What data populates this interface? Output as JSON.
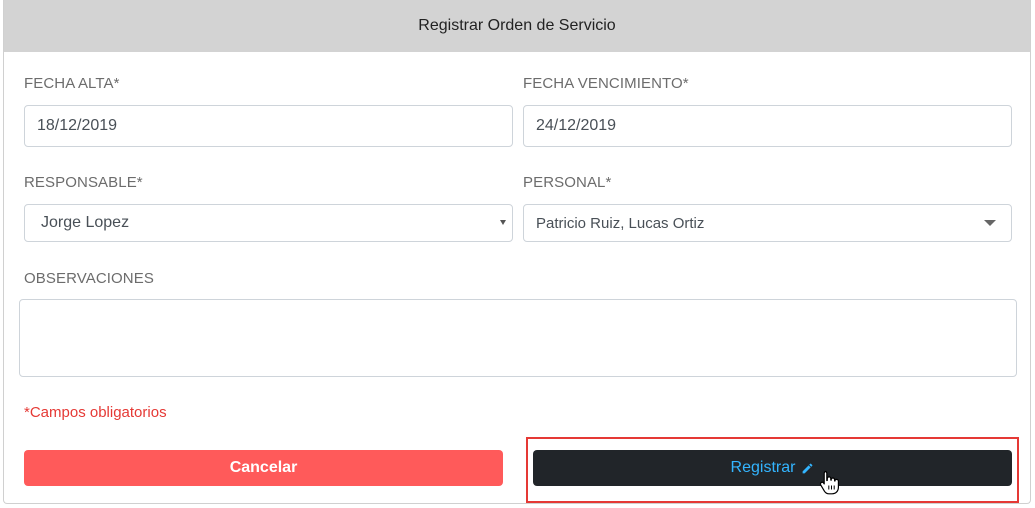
{
  "modal": {
    "title": "Registrar Orden de Servicio"
  },
  "form": {
    "fecha_alta": {
      "label": "FECHA ALTA*",
      "value": "18/12/2019"
    },
    "fecha_vencimiento": {
      "label": "FECHA VENCIMIENTO*",
      "value": "24/12/2019"
    },
    "responsable": {
      "label": "RESPONSABLE*",
      "value": "Jorge Lopez"
    },
    "personal": {
      "label": "PERSONAL*",
      "value": "Patricio Ruiz, Lucas Ortiz"
    },
    "observaciones": {
      "label": "OBSERVACIONES",
      "value": ""
    },
    "required_note": "*Campos obligatorios"
  },
  "actions": {
    "cancel_label": "Cancelar",
    "submit_label": "Registrar"
  },
  "icons": {
    "submit": "pencil-icon",
    "cursor": "hand-pointer-icon"
  },
  "colors": {
    "header_bg": "#d3d3d3",
    "cancel_bg": "#ff5a5a",
    "submit_bg": "#212529",
    "submit_text": "#33b5ff",
    "required_text": "#e53935",
    "highlight_border": "#e53935"
  }
}
